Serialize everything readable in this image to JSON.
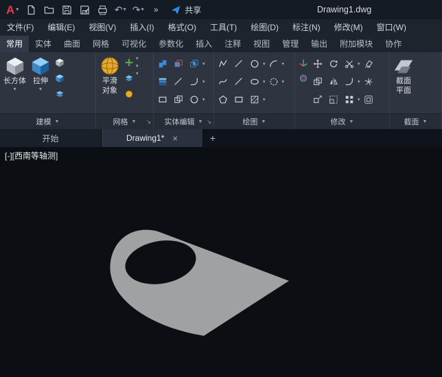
{
  "glyphs": {
    "logo_letter": "A",
    "caret": "▾",
    "panel_caret": "▼",
    "launcher": "↘",
    "close": "×",
    "plus": "+",
    "overflow": "»",
    "undo": "↶",
    "redo": "↷"
  },
  "titlebar": {
    "title": "Drawing1.dwg",
    "share": "共享"
  },
  "menubar": {
    "items": [
      "文件(F)",
      "编辑(E)",
      "视图(V)",
      "插入(I)",
      "格式(O)",
      "工具(T)",
      "绘图(D)",
      "标注(N)",
      "修改(M)",
      "窗口(W)"
    ]
  },
  "ribbon": {
    "tabs": [
      "常用",
      "实体",
      "曲面",
      "网格",
      "可视化",
      "参数化",
      "插入",
      "注释",
      "视图",
      "管理",
      "输出",
      "附加模块",
      "协作"
    ],
    "active_tab": "常用",
    "panels": {
      "modeling": {
        "label": "建模",
        "box_label": "长方体",
        "extrude_label": "拉伸"
      },
      "mesh": {
        "label": "网格",
        "smooth_label_1": "平滑",
        "smooth_label_2": "对象"
      },
      "solid": {
        "label": "实体编辑"
      },
      "draw": {
        "label": "绘图"
      },
      "modify": {
        "label": "修改"
      },
      "section": {
        "label": "截面",
        "plane_label_1": "截面",
        "plane_label_2": "平面"
      }
    }
  },
  "filetabs": {
    "start": "开始",
    "active": "Drawing1*"
  },
  "canvas": {
    "viewport_label": "[-][西南等轴测]",
    "model_color": "#9fa1a3",
    "background": "#0b0e13",
    "accent_blue": "#2f9bf2",
    "logo_red": "#e33b49"
  }
}
